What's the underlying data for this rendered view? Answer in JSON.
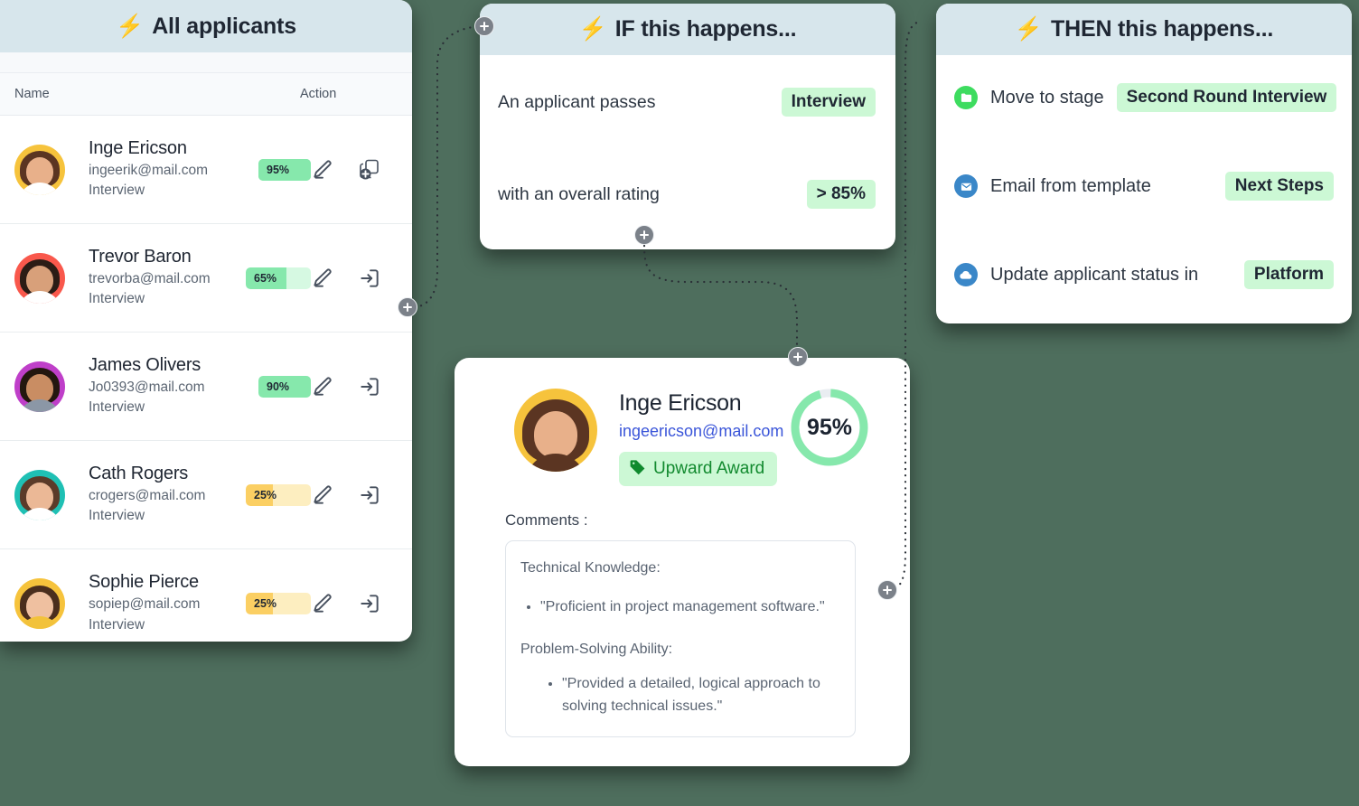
{
  "applicants_panel": {
    "title": "All applicants",
    "bolt_icon": "lightning-bolt-icon",
    "columns": {
      "name": "Name",
      "action": "Action"
    },
    "rows": [
      {
        "name": "Inge Ericson",
        "email": "ingeerik@mail.com",
        "stage": "Interview",
        "score": "95%",
        "score_value": 95,
        "bar_color": "#86e8ac",
        "bar_track": "#86e8ac",
        "edit_icon": "pencil-icon",
        "action_icon": "add-copy-icon",
        "avatar": {
          "bg": "#f6c33c",
          "hair": "#5b3522",
          "skin": "#e8b08a",
          "body": "#ffffff"
        }
      },
      {
        "name": "Trevor Baron",
        "email": "trevorba@mail.com",
        "stage": "Interview",
        "score": "65%",
        "score_value": 65,
        "bar_color": "#86e8ac",
        "bar_track": "#d6f9e2",
        "edit_icon": "pencil-icon",
        "action_icon": "log-in-icon",
        "avatar": {
          "bg": "#f9584c",
          "hair": "#2b1c15",
          "skin": "#d8a07a",
          "body": "#ffffff"
        }
      },
      {
        "name": "James Olivers",
        "email": "Jo0393@mail.com",
        "stage": "Interview",
        "score": "90%",
        "score_value": 90,
        "bar_color": "#86e8ac",
        "bar_track": "#d6f9e2",
        "edit_icon": "pencil-icon",
        "action_icon": "log-in-icon",
        "avatar": {
          "bg": "#bf3fc9",
          "hair": "#23170f",
          "skin": "#c98d63",
          "body": "#8b97a6"
        }
      },
      {
        "name": "Cath Rogers",
        "email": "crogers@mail.com",
        "stage": "Interview",
        "score": "25%",
        "score_value": 25,
        "bar_color": "#fbcf63",
        "bar_track": "#fdeec0",
        "edit_icon": "pencil-icon",
        "action_icon": "log-in-icon",
        "avatar": {
          "bg": "#1fc0b4",
          "hair": "#5b3b29",
          "skin": "#ebb896",
          "body": "#ffffff"
        }
      },
      {
        "name": "Sophie Pierce",
        "email": "sopiep@mail.com",
        "stage": "Interview",
        "score": "25%",
        "score_value": 25,
        "bar_color": "#fbcf63",
        "bar_track": "#fdeec0",
        "edit_icon": "pencil-icon",
        "action_icon": "log-in-icon",
        "avatar": {
          "bg": "#f6c33c",
          "hair": "#4a2e1d",
          "skin": "#efc0a0",
          "body": "#f2c23b"
        }
      }
    ]
  },
  "if_card": {
    "title": "IF this happens...",
    "bolt_icon": "lightning-bolt-icon",
    "conditions": [
      {
        "text": "An applicant passes",
        "value": "Interview"
      },
      {
        "text": "with an overall rating",
        "value": "> 85%"
      }
    ]
  },
  "then_card": {
    "title": "THEN this happens...",
    "bolt_icon": "lightning-bolt-icon",
    "actions": [
      {
        "icon": "folder-icon",
        "icon_bg": "#3ddc5f",
        "text": "Move to stage",
        "value": "Second Round Interview"
      },
      {
        "icon": "envelope-icon",
        "icon_bg": "#3a87c8",
        "text": "Email from template",
        "value": "Next Steps"
      },
      {
        "icon": "cloud-icon",
        "icon_bg": "#3a87c8",
        "text": "Update applicant status in",
        "value": "Platform"
      }
    ]
  },
  "profile_card": {
    "name": "Inge Ericson",
    "email": "ingeericson@mail.com",
    "award": "Upward Award",
    "award_icon": "tag-icon",
    "score": "95%",
    "score_value": 95,
    "ring_color": "#86e8ac",
    "comments_label": "Comments :",
    "comments": {
      "heading1": "Technical Knowledge:",
      "bullet1": "\"Proficient in project management software.\"",
      "heading2": "Problem-Solving Ability:",
      "bullet2": "\"Provided a detailed, logical approach to solving technical issues.\""
    }
  },
  "theme": {
    "page_bg": "#4e6e5d",
    "header_bg": "#d7e6ec",
    "pill_bg": "#ccf8d5",
    "green": "#86e8ac",
    "yellow": "#fbcf63",
    "link": "#3a55d9"
  }
}
